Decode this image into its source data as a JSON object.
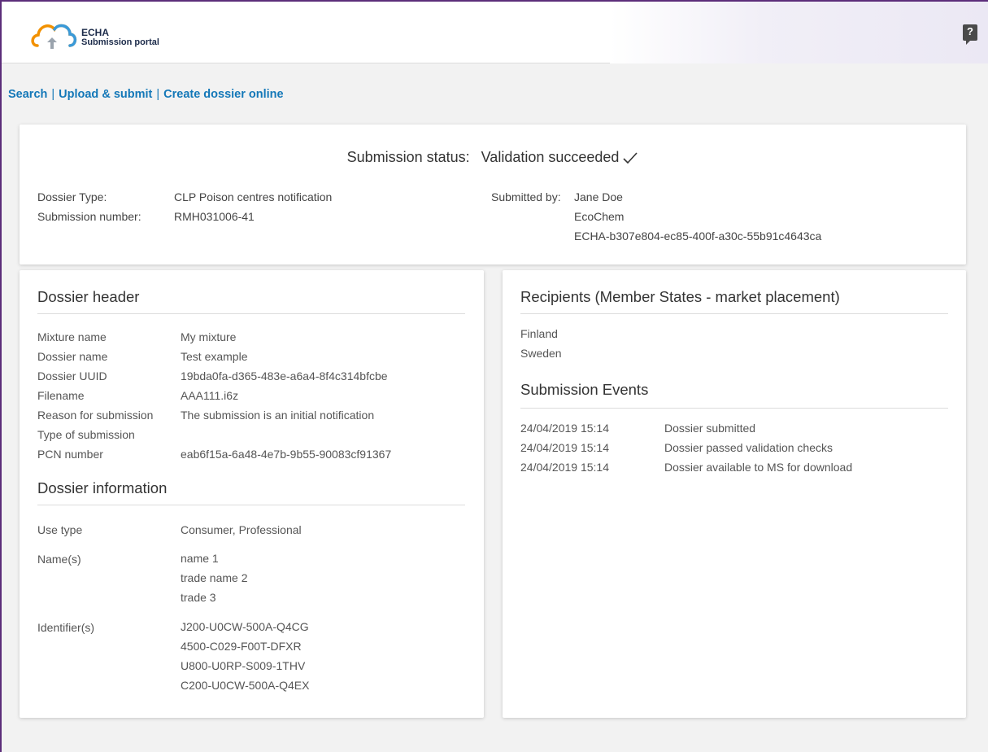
{
  "header": {
    "logo_line1": "ECHA",
    "logo_line2": "Submission portal",
    "help_label": "?"
  },
  "nav": {
    "links": [
      "Search",
      "Upload & submit",
      "Create dossier online"
    ],
    "separator": "|"
  },
  "status": {
    "label": "Submission status:",
    "value": "Validation succeeded",
    "dossier_type_label": "Dossier Type:",
    "dossier_type_value": "CLP Poison centres notification",
    "submission_number_label": "Submission number:",
    "submission_number_value": "RMH031006-41",
    "submitted_by_label": "Submitted by:",
    "submitted_by_name": "Jane Doe",
    "submitted_by_company": "EcoChem",
    "submitted_by_id": "ECHA-b307e804-ec85-400f-a30c-55b91c4643ca"
  },
  "dossier_header": {
    "title": "Dossier header",
    "rows": [
      {
        "label": "Mixture name",
        "value": "My mixture"
      },
      {
        "label": "Dossier name",
        "value": "Test example"
      },
      {
        "label": "Dossier UUID",
        "value": "19bda0fa-d365-483e-a6a4-8f4c314bfcbe"
      },
      {
        "label": "Filename",
        "value": "AAA111.i6z"
      },
      {
        "label": "Reason for submission",
        "value": "The submission is an initial notification"
      },
      {
        "label": "Type of submission",
        "value": ""
      },
      {
        "label": "PCN number",
        "value": "eab6f15a-6a48-4e7b-9b55-90083cf91367"
      }
    ]
  },
  "dossier_information": {
    "title": "Dossier information",
    "use_type_label": "Use type",
    "use_type_value": "Consumer, Professional",
    "names_label": "Name(s)",
    "names": [
      "name 1",
      "trade name 2",
      "trade 3"
    ],
    "identifiers_label": "Identifier(s)",
    "identifiers": [
      "J200-U0CW-500A-Q4CG",
      "4500-C029-F00T-DFXR",
      "U800-U0RP-S009-1THV",
      "C200-U0CW-500A-Q4EX"
    ]
  },
  "recipients": {
    "title": "Recipients (Member States - market placement)",
    "items": [
      "Finland",
      "Sweden"
    ]
  },
  "events": {
    "title": "Submission Events",
    "rows": [
      {
        "time": "24/04/2019 15:14",
        "event": "Dossier submitted"
      },
      {
        "time": "24/04/2019 15:14",
        "event": "Dossier passed validation checks"
      },
      {
        "time": "24/04/2019 15:14",
        "event": "Dossier available to MS for download"
      }
    ]
  },
  "colors": {
    "link": "#1478b8",
    "frame": "#5c2d7a",
    "logo_orange": "#f29100",
    "logo_blue": "#3a9ad9"
  }
}
